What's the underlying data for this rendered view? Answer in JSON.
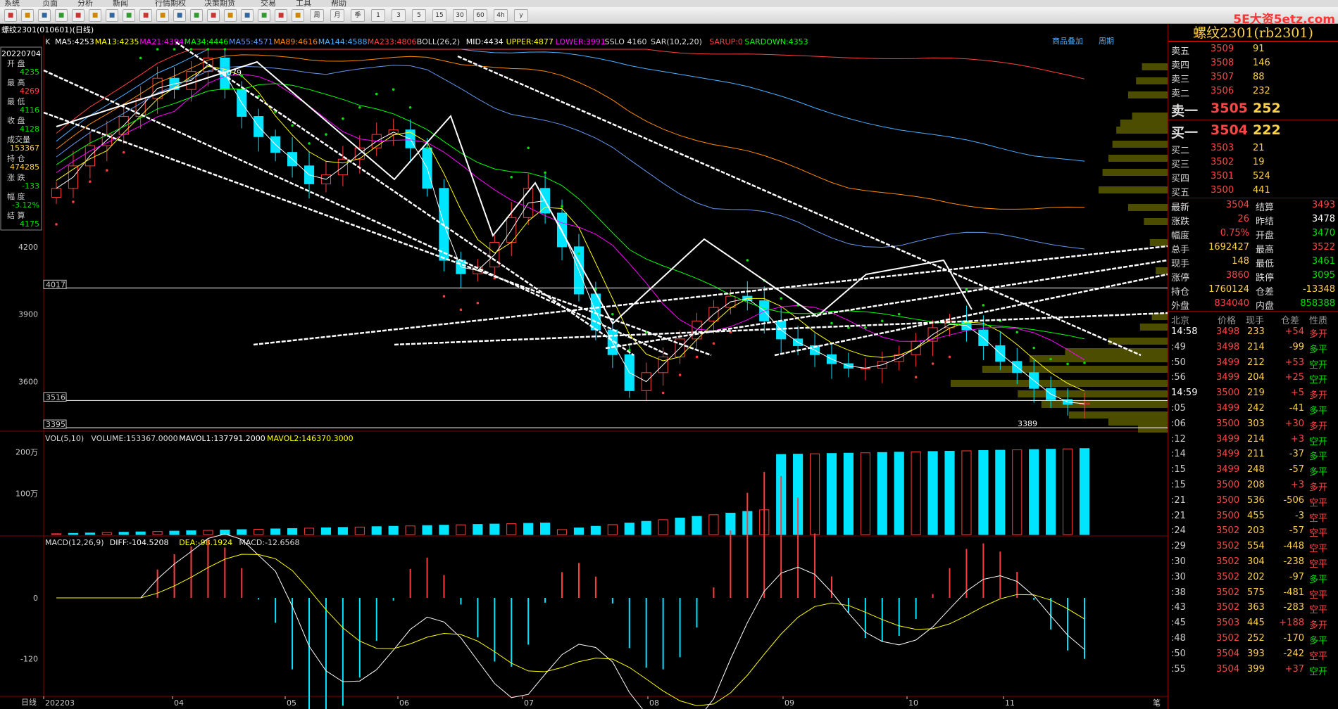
{
  "menu": [
    "系统",
    "页面",
    "分析",
    "新闻",
    "行情期权",
    "决策期货",
    "交易",
    "工具",
    "帮助"
  ],
  "toolbar": {
    "brand": "5E大资5etz.com",
    "period_buttons": [
      "周",
      "月",
      "季",
      "1",
      "3",
      "5",
      "15",
      "30",
      "60",
      "4h",
      "y"
    ]
  },
  "window_title": "螺纹2301(010601)(日线)",
  "indicators": {
    "k_label": "K",
    "ma": [
      {
        "text": "MA5:4253",
        "color": "#ffffff"
      },
      {
        "text": "MA13:4235",
        "color": "#ffff00"
      },
      {
        "text": "MA21:4394",
        "color": "#ff00ff"
      },
      {
        "text": "MA34:4446",
        "color": "#00ff00"
      },
      {
        "text": "MA55:4571",
        "color": "#6495ed"
      },
      {
        "text": "MA89:4616",
        "color": "#ff8c00"
      },
      {
        "text": "MA144:4588",
        "color": "#4ab0ff"
      },
      {
        "text": "MA233:4806",
        "color": "#ff4040"
      }
    ],
    "boll": [
      {
        "text": "BOLL(26,2)",
        "color": "#dddddd"
      },
      {
        "text": "MID:4434",
        "color": "#ffffff"
      },
      {
        "text": "UPPER:4877",
        "color": "#ffff00"
      },
      {
        "text": "LOWER:3991",
        "color": "#ff00ff"
      }
    ],
    "sslo": {
      "text": "SSLO 4160",
      "color": "#dddddd"
    },
    "sar": [
      {
        "text": "SAR(10,2,20)",
        "color": "#dddddd"
      },
      {
        "text": "SARUP:0",
        "color": "#ff4040"
      },
      {
        "text": "SARDOWN:4353",
        "color": "#00ff00"
      }
    ],
    "top_right": [
      "商品叠加",
      "周期"
    ]
  },
  "ohlc_box": {
    "date": "20220704",
    "rows": [
      {
        "label": "开 盘",
        "value": "4235",
        "color": "#00e000"
      },
      {
        "label": "最 高",
        "value": "4269",
        "color": "#ff4545"
      },
      {
        "label": "最 低",
        "value": "4116",
        "color": "#00e000"
      },
      {
        "label": "收 盘",
        "value": "4128",
        "color": "#00e000"
      },
      {
        "label": "成交量",
        "value": "153367",
        "color": "#ffd24a"
      },
      {
        "label": "持 仓",
        "value": "474285",
        "color": "#ffd24a"
      },
      {
        "label": "涨 跌",
        "value": "-133",
        "color": "#00e000"
      },
      {
        "label": "幅 度",
        "value": "-3.12%",
        "color": "#00e000"
      },
      {
        "label": "结 算",
        "value": "4175",
        "color": "#00e000"
      }
    ]
  },
  "price_axis": {
    "labels": [
      "4200",
      "3900",
      "3600"
    ],
    "boxes": [
      "4017",
      "3516",
      "3395"
    ],
    "annotations": [
      "5079",
      "3389"
    ]
  },
  "volume": {
    "header": [
      {
        "text": "VOL(5,10)",
        "color": "#dddddd"
      },
      {
        "text": "VOLUME:153367.0000",
        "color": "#dddddd"
      },
      {
        "text": "MAVOL1:137791.2000",
        "color": "#ffffff"
      },
      {
        "text": "MAVOL2:146370.3000",
        "color": "#ffff00"
      }
    ],
    "axis_labels": [
      "200万",
      "100万"
    ]
  },
  "macd": {
    "header": [
      {
        "text": "MACD(12,26,9)",
        "color": "#dddddd"
      },
      {
        "text": "DIFF:-104.5208",
        "color": "#ffffff"
      },
      {
        "text": "DEA:-98.1924",
        "color": "#ffff00"
      },
      {
        "text": "MACD:-12.6568",
        "color": "#dddddd"
      }
    ],
    "axis_labels": [
      "0",
      "-120"
    ]
  },
  "x_axis": {
    "period": "日线",
    "labels": [
      "202203",
      "04",
      "05",
      "06",
      "07",
      "08",
      "09",
      "10",
      "11"
    ],
    "right_label": "笔"
  },
  "chart_data": {
    "type": "candlestick",
    "title": "螺纹2301(010601)(日线)",
    "x": [
      "202203",
      "04",
      "05",
      "06",
      "07",
      "08",
      "09",
      "10",
      "11"
    ],
    "ylim": [
      3389,
      5079
    ],
    "close": [
      4460,
      4560,
      4650,
      4700,
      4780,
      4860,
      4950,
      4900,
      4980,
      5040,
      4900,
      4780,
      4690,
      4620,
      4560,
      4480,
      4520,
      4590,
      4640,
      4700,
      4720,
      4640,
      4460,
      4140,
      4080,
      4110,
      4220,
      4330,
      4460,
      4350,
      4200,
      3990,
      3830,
      3720,
      3560,
      3640,
      3710,
      3790,
      3870,
      3930,
      3980,
      3960,
      3870,
      3790,
      3760,
      3720,
      3680,
      3660,
      3660,
      3690,
      3720,
      3780,
      3840,
      3870,
      3830,
      3760,
      3690,
      3640,
      3570,
      3520,
      3499,
      3504
    ],
    "series": [
      {
        "name": "MA5",
        "color": "#ffffff"
      },
      {
        "name": "MA13",
        "color": "#ffff00"
      },
      {
        "name": "MA21",
        "color": "#ff00ff"
      },
      {
        "name": "MA34",
        "color": "#00ff00"
      },
      {
        "name": "MA55",
        "color": "#6495ed"
      },
      {
        "name": "MA89",
        "color": "#ff8c00"
      },
      {
        "name": "MA144",
        "color": "#4ab0ff"
      },
      {
        "name": "MA233",
        "color": "#ff4040"
      }
    ],
    "grid": false,
    "legend": "top-left"
  },
  "quote": {
    "title": "螺纹2301(rb2301)",
    "asks": [
      {
        "label": "卖五",
        "price": "3509",
        "vol": "91"
      },
      {
        "label": "卖四",
        "price": "3508",
        "vol": "146"
      },
      {
        "label": "卖三",
        "price": "3507",
        "vol": "88"
      },
      {
        "label": "卖二",
        "price": "3506",
        "vol": "232"
      },
      {
        "label": "卖一",
        "price": "3505",
        "vol": "252"
      }
    ],
    "bids": [
      {
        "label": "买一",
        "price": "3504",
        "vol": "222"
      },
      {
        "label": "买二",
        "price": "3503",
        "vol": "21"
      },
      {
        "label": "买三",
        "price": "3502",
        "vol": "19"
      },
      {
        "label": "买四",
        "price": "3501",
        "vol": "524"
      },
      {
        "label": "买五",
        "price": "3500",
        "vol": "441"
      }
    ],
    "stats": [
      {
        "l1": "最新",
        "v1": "3504",
        "c1": "#ff4545",
        "l2": "结算",
        "v2": "3493",
        "c2": "#ff4545"
      },
      {
        "l1": "涨跌",
        "v1": "26",
        "c1": "#ff4545",
        "l2": "昨结",
        "v2": "3478",
        "c2": "#ffffff"
      },
      {
        "l1": "幅度",
        "v1": "0.75%",
        "c1": "#ff4545",
        "l2": "开盘",
        "v2": "3470",
        "c2": "#00e000"
      },
      {
        "l1": "总手",
        "v1": "1692427",
        "c1": "#ffd24a",
        "l2": "最高",
        "v2": "3522",
        "c2": "#ff4545"
      },
      {
        "l1": "现手",
        "v1": "148",
        "c1": "#ffd24a",
        "l2": "最低",
        "v2": "3461",
        "c2": "#00e000"
      },
      {
        "l1": "涨停",
        "v1": "3860",
        "c1": "#ff4545",
        "l2": "跌停",
        "v2": "3095",
        "c2": "#00e000"
      },
      {
        "l1": "持仓",
        "v1": "1760124",
        "c1": "#ffd24a",
        "l2": "仓差",
        "v2": "-13348",
        "c2": "#ffd24a"
      },
      {
        "l1": "外盘",
        "v1": "834040",
        "c1": "#ff4545",
        "l2": "内盘",
        "v2": "858388",
        "c2": "#00e000"
      }
    ],
    "tick_header": [
      "北京",
      "价格",
      "现手",
      "仓差",
      "性质"
    ],
    "ticks": [
      {
        "t": "14:58",
        "p": "3498",
        "v": "233",
        "d": "+54",
        "n": "多开",
        "pc": "#ff4545",
        "nc": "#ff4545"
      },
      {
        "t": ":49",
        "p": "3498",
        "v": "214",
        "d": "-99",
        "n": "多平",
        "pc": "#ff4545",
        "nc": "#00e000"
      },
      {
        "t": ":50",
        "p": "3499",
        "v": "212",
        "d": "+53",
        "n": "空开",
        "pc": "#ff4545",
        "nc": "#00e000"
      },
      {
        "t": ":56",
        "p": "3499",
        "v": "204",
        "d": "+25",
        "n": "空开",
        "pc": "#ff4545",
        "nc": "#00e000"
      },
      {
        "t": "14:59",
        "p": "3500",
        "v": "219",
        "d": "+5",
        "n": "多开",
        "pc": "#ff4545",
        "nc": "#ff4545"
      },
      {
        "t": ":05",
        "p": "3499",
        "v": "242",
        "d": "-41",
        "n": "多平",
        "pc": "#ff4545",
        "nc": "#00e000"
      },
      {
        "t": ":06",
        "p": "3500",
        "v": "303",
        "d": "+30",
        "n": "多开",
        "pc": "#ff4545",
        "nc": "#ff4545"
      },
      {
        "t": ":12",
        "p": "3499",
        "v": "214",
        "d": "+3",
        "n": "空开",
        "pc": "#ff4545",
        "nc": "#00e000"
      },
      {
        "t": ":14",
        "p": "3499",
        "v": "211",
        "d": "-37",
        "n": "多平",
        "pc": "#ff4545",
        "nc": "#00e000"
      },
      {
        "t": ":15",
        "p": "3499",
        "v": "248",
        "d": "-57",
        "n": "多平",
        "pc": "#ff4545",
        "nc": "#00e000"
      },
      {
        "t": ":15",
        "p": "3500",
        "v": "208",
        "d": "+3",
        "n": "多开",
        "pc": "#ff4545",
        "nc": "#ff4545"
      },
      {
        "t": ":21",
        "p": "3500",
        "v": "536",
        "d": "-506",
        "n": "空平",
        "pc": "#ff4545",
        "nc": "#ff4545"
      },
      {
        "t": ":21",
        "p": "3500",
        "v": "455",
        "d": "-3",
        "n": "空平",
        "pc": "#ff4545",
        "nc": "#ff4545"
      },
      {
        "t": ":24",
        "p": "3502",
        "v": "203",
        "d": "-57",
        "n": "空平",
        "pc": "#ff4545",
        "nc": "#ff4545"
      },
      {
        "t": ":29",
        "p": "3502",
        "v": "554",
        "d": "-448",
        "n": "空平",
        "pc": "#ff4545",
        "nc": "#ff4545"
      },
      {
        "t": ":30",
        "p": "3502",
        "v": "304",
        "d": "-238",
        "n": "空平",
        "pc": "#ff4545",
        "nc": "#ff4545"
      },
      {
        "t": ":30",
        "p": "3502",
        "v": "202",
        "d": "-97",
        "n": "多平",
        "pc": "#ff4545",
        "nc": "#00e000"
      },
      {
        "t": ":38",
        "p": "3502",
        "v": "575",
        "d": "-481",
        "n": "空平",
        "pc": "#ff4545",
        "nc": "#ff4545"
      },
      {
        "t": ":43",
        "p": "3502",
        "v": "363",
        "d": "-283",
        "n": "空平",
        "pc": "#ff4545",
        "nc": "#ff4545"
      },
      {
        "t": ":45",
        "p": "3503",
        "v": "445",
        "d": "+188",
        "n": "多开",
        "pc": "#ff4545",
        "nc": "#ff4545"
      },
      {
        "t": ":48",
        "p": "3502",
        "v": "252",
        "d": "-170",
        "n": "多平",
        "pc": "#ff4545",
        "nc": "#00e000"
      },
      {
        "t": ":50",
        "p": "3504",
        "v": "393",
        "d": "-242",
        "n": "空平",
        "pc": "#ff4545",
        "nc": "#ff4545"
      },
      {
        "t": ":55",
        "p": "3504",
        "v": "399",
        "d": "+37",
        "n": "空开",
        "pc": "#ff4545",
        "nc": "#00e000"
      }
    ]
  }
}
